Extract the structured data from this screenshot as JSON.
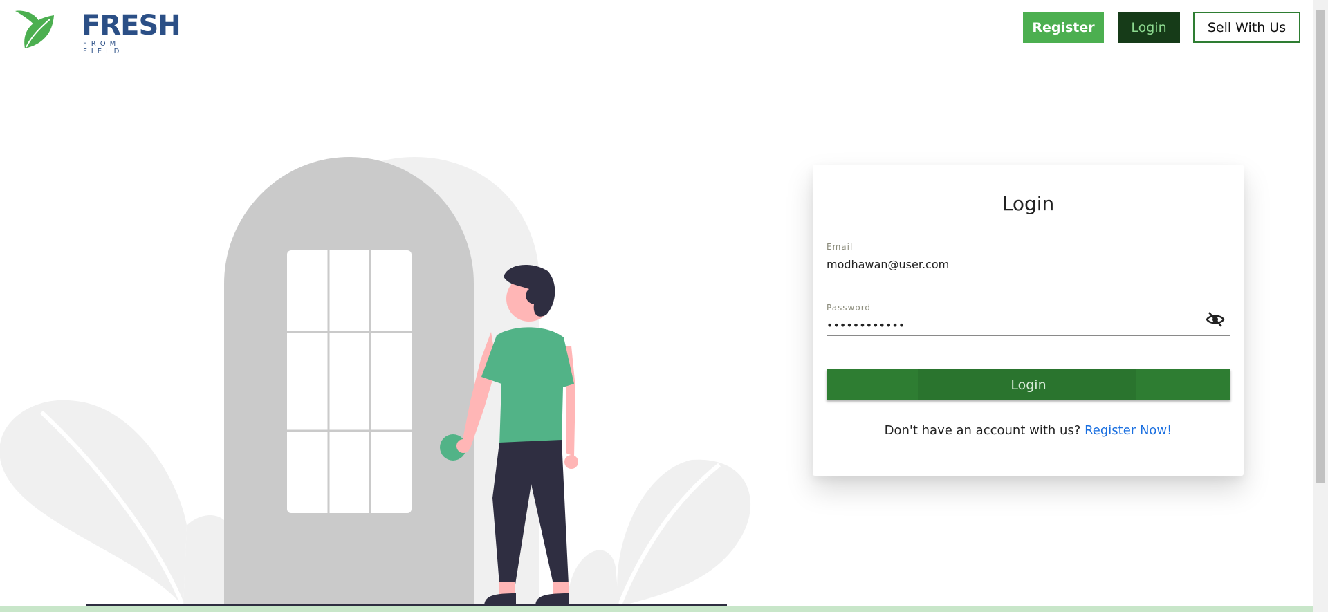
{
  "brand": {
    "name": "FRESH",
    "tagline": "FROM FIELD",
    "primary_color": "#2b4f86",
    "leaf_color": "#4caf50"
  },
  "nav": {
    "register_label": "Register",
    "login_label": "Login",
    "sell_label": "Sell With Us"
  },
  "login_form": {
    "title": "Login",
    "email_label": "Email",
    "email_value": "modhawan@user.com",
    "password_label": "Password",
    "password_value": "••••••••••••",
    "password_visibility_icon": "eye-off-icon",
    "submit_label": "Login",
    "register_prompt": "Don't have an account with us?",
    "register_link": "Register Now!"
  },
  "colors": {
    "accent_green": "#4caf50",
    "dark_green": "#163b18",
    "submit_green": "#2e7d32",
    "link_blue": "#1a6fe0"
  }
}
